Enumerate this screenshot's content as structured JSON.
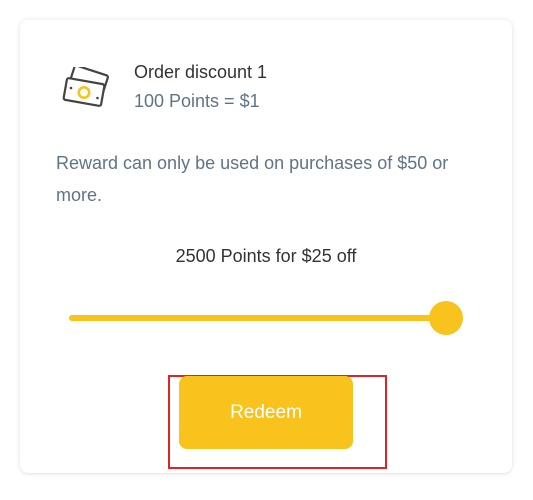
{
  "reward": {
    "icon": "money-bills-icon",
    "title": "Order discount 1",
    "rate": "100 Points = $1",
    "description": "Reward can only be used on purchases of $50 or more."
  },
  "slider": {
    "value_text": "2500 Points for $25 off",
    "fill_fraction": 1.0
  },
  "redeem": {
    "label": "Redeem"
  },
  "colors": {
    "accent": "#f7c31c",
    "title_text": "#333333",
    "secondary_text": "#5f7486",
    "highlight_border": "#e02424",
    "card_background": "#ffffff"
  }
}
